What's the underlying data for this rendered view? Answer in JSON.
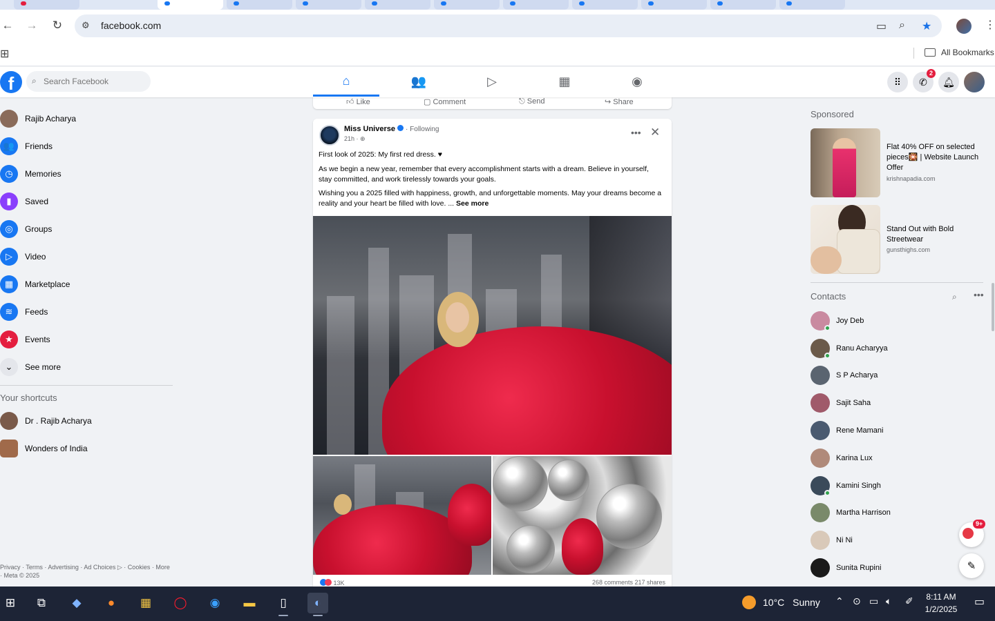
{
  "browser": {
    "url": "facebook.com",
    "all_bookmarks": "All Bookmarks"
  },
  "fb": {
    "search_placeholder": "Search Facebook",
    "logo_letter": "f",
    "messenger_badge": "2"
  },
  "left_sidebar": {
    "items": [
      {
        "label": "Rajib Acharya",
        "icon": "profile-avatar",
        "color": "#8a6b5a"
      },
      {
        "label": "Friends",
        "icon": "friends-icon",
        "color": "#1877f2"
      },
      {
        "label": "Memories",
        "icon": "memories-clock-icon",
        "color": "#1877f2"
      },
      {
        "label": "Saved",
        "icon": "bookmark-icon",
        "color": "#8a3ffc"
      },
      {
        "label": "Groups",
        "icon": "groups-icon",
        "color": "#1877f2"
      },
      {
        "label": "Video",
        "icon": "video-icon",
        "color": "#1877f2"
      },
      {
        "label": "Marketplace",
        "icon": "marketplace-icon",
        "color": "#1877f2"
      },
      {
        "label": "Feeds",
        "icon": "feeds-icon",
        "color": "#1877f2"
      },
      {
        "label": "Events",
        "icon": "events-icon",
        "color": "#e41e3f"
      },
      {
        "label": "See more",
        "icon": "chevron-down-icon",
        "color": "#e4e6eb"
      }
    ],
    "shortcuts_title": "Your shortcuts",
    "shortcuts": [
      {
        "label": "Dr . Rajib Acharya"
      },
      {
        "label": "Wonders of India"
      }
    ],
    "footer": "Privacy · Terms · Advertising · Ad Choices ▷ · Cookies · More · Meta © 2025"
  },
  "feed": {
    "actions": [
      "Like",
      "Comment",
      "Send",
      "Share"
    ],
    "post": {
      "author": "Miss Universe",
      "following": "· Following",
      "time": "21h · ",
      "line1": "First look of 2025: My first red dress. ♥",
      "line2": "As we begin a new year, remember that every accomplishment starts with a dream. Believe in yourself, stay committed, and work tirelessly towards your goals.",
      "line3": "Wishing you a 2025 filled with happiness, growth, and unforgettable moments. May your dreams become a reality and your heart be filled with love. ...",
      "see_more": "See more",
      "reactions": "13K",
      "comments_shares": "268 comments  217 shares"
    }
  },
  "right_sidebar": {
    "sponsored_title": "Sponsored",
    "ads": [
      {
        "title": "Flat 40% OFF on selected pieces🎇 | Website Launch Offer",
        "domain": "krishnapadia.com"
      },
      {
        "title": "Stand Out with Bold Streetwear",
        "domain": "gunsthighs.com"
      }
    ],
    "contacts_title": "Contacts",
    "contacts": [
      {
        "name": "Joy Deb",
        "online": true,
        "color": "#c98aa0"
      },
      {
        "name": "Ranu Acharyya",
        "online": true,
        "color": "#6b5a4a"
      },
      {
        "name": "S P Acharya",
        "online": false,
        "color": "#5a6470"
      },
      {
        "name": "Sajit Saha",
        "online": false,
        "color": "#a05a6a"
      },
      {
        "name": "Rene Mamani",
        "online": false,
        "color": "#4a5a70"
      },
      {
        "name": "Karina Lux",
        "online": false,
        "color": "#b08a7a"
      },
      {
        "name": "Kamini Singh",
        "online": true,
        "color": "#3a4a5a"
      },
      {
        "name": "Martha Harrison",
        "online": false,
        "color": "#7a8a6a"
      },
      {
        "name": "Ni Ni",
        "online": false,
        "color": "#d9c9b9"
      },
      {
        "name": "Sunita Rupini",
        "online": false,
        "color": "#1a1a1a"
      }
    ],
    "chat_badge": "9+"
  },
  "taskbar": {
    "weather_temp": "10°C",
    "weather_text": "Sunny",
    "time": "8:11 AM",
    "date": "1/2/2025"
  }
}
